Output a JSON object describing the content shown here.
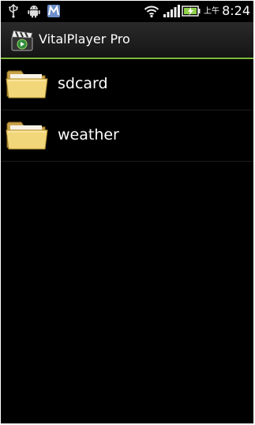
{
  "status_bar": {
    "icons": [
      "usb-icon",
      "android-debug-icon",
      "maps-icon",
      "wifi-icon",
      "signal-icon",
      "battery-charging-icon"
    ],
    "ampm": "上午",
    "time": "8:24"
  },
  "app_bar": {
    "icon": "clapperboard-icon",
    "title": "VitalPlayer Pro",
    "accent_color": "#7db83c"
  },
  "file_list": {
    "items": [
      {
        "label": "sdcard",
        "icon": "folder-icon"
      },
      {
        "label": "weather",
        "icon": "folder-icon"
      }
    ]
  }
}
